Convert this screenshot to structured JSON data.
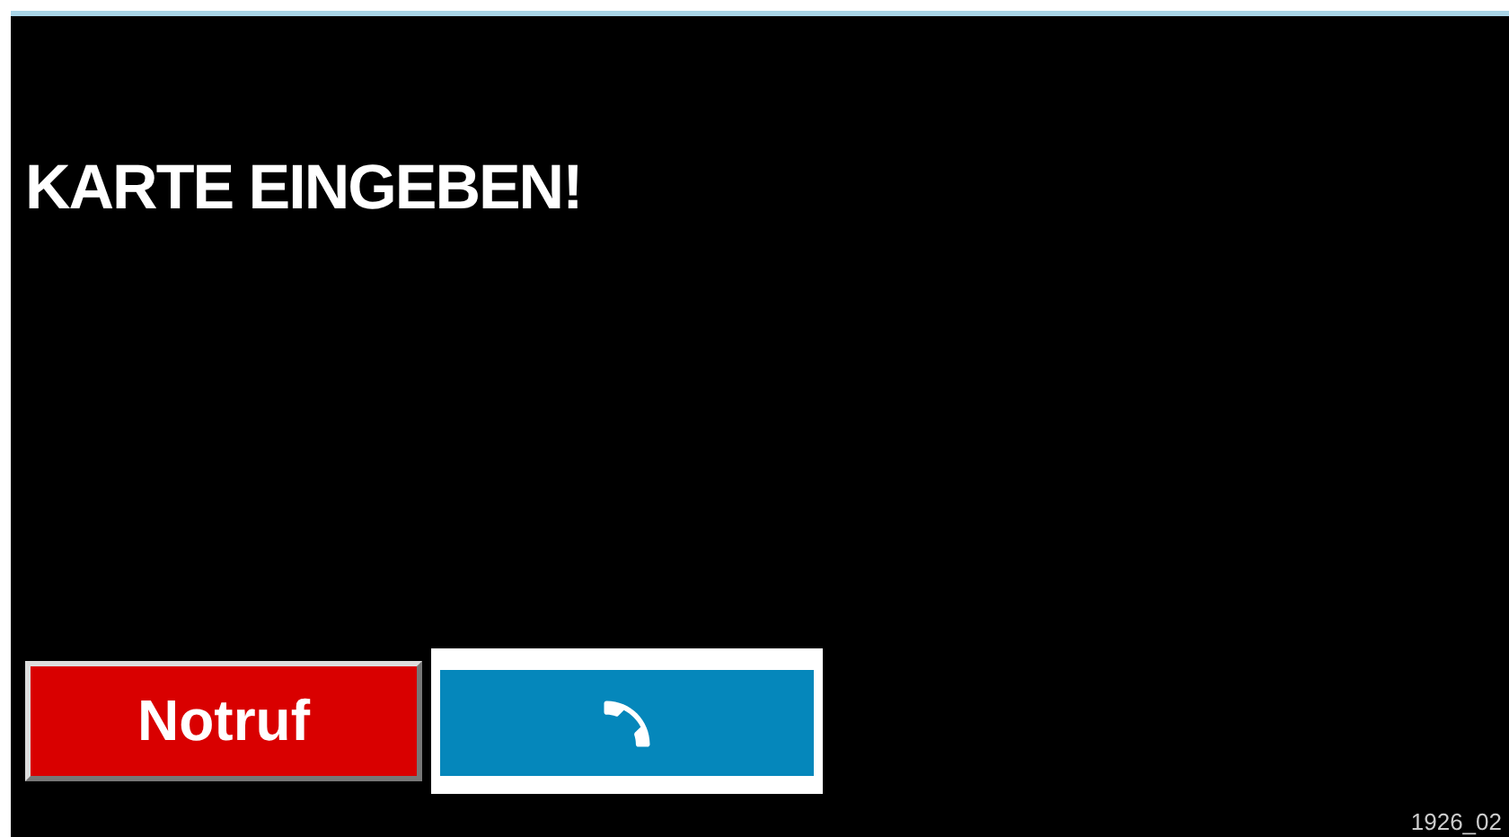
{
  "message": "KARTE EINGEBEN!",
  "buttons": [
    {
      "kind": "emergency",
      "label": "Notruf"
    },
    {
      "kind": "call"
    }
  ],
  "footer_code": "1926_02"
}
